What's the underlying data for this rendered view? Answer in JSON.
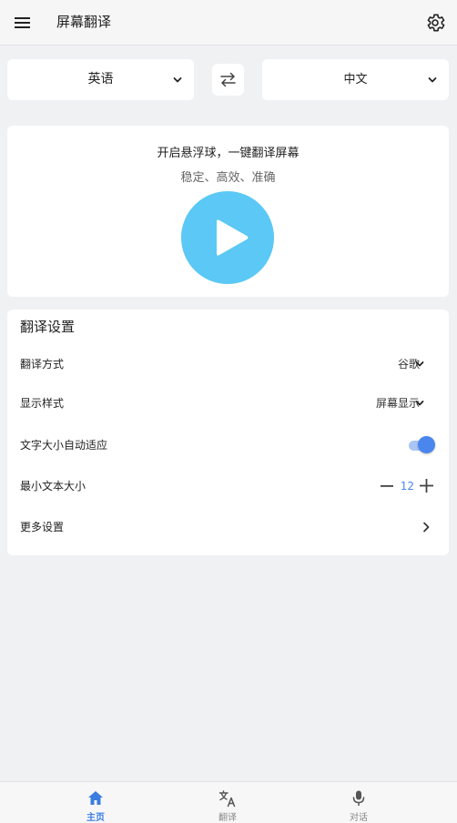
{
  "header": {
    "title": "屏幕翻译",
    "menu_icon": "menu-icon",
    "settings_icon": "gear-icon"
  },
  "languages": {
    "source": "英语",
    "target": "中文",
    "swap_icon": "swap-arrows-icon"
  },
  "float_card": {
    "title": "开启悬浮球，一键翻译屏幕",
    "subtitle": "稳定、高效、准确",
    "play_icon": "play-icon"
  },
  "settings": {
    "title": "翻译设置",
    "translate_method": {
      "label": "翻译方式",
      "value": "谷歌"
    },
    "display_style": {
      "label": "显示样式",
      "value": "屏幕显示"
    },
    "auto_font_size": {
      "label": "文字大小自动适应",
      "enabled": true
    },
    "min_text_size": {
      "label": "最小文本大小",
      "value": "12"
    },
    "more_settings": {
      "label": "更多设置"
    }
  },
  "bottom_nav": {
    "items": [
      {
        "label": "主页",
        "icon": "home-icon",
        "active": true
      },
      {
        "label": "翻译",
        "icon": "translate-icon",
        "active": false
      },
      {
        "label": "对话",
        "icon": "microphone-icon",
        "active": false
      }
    ]
  },
  "colors": {
    "accent": "#4a86ee",
    "play_button": "#5bc8f5",
    "nav_active": "#3b7de0",
    "background": "#f0f1f3"
  }
}
